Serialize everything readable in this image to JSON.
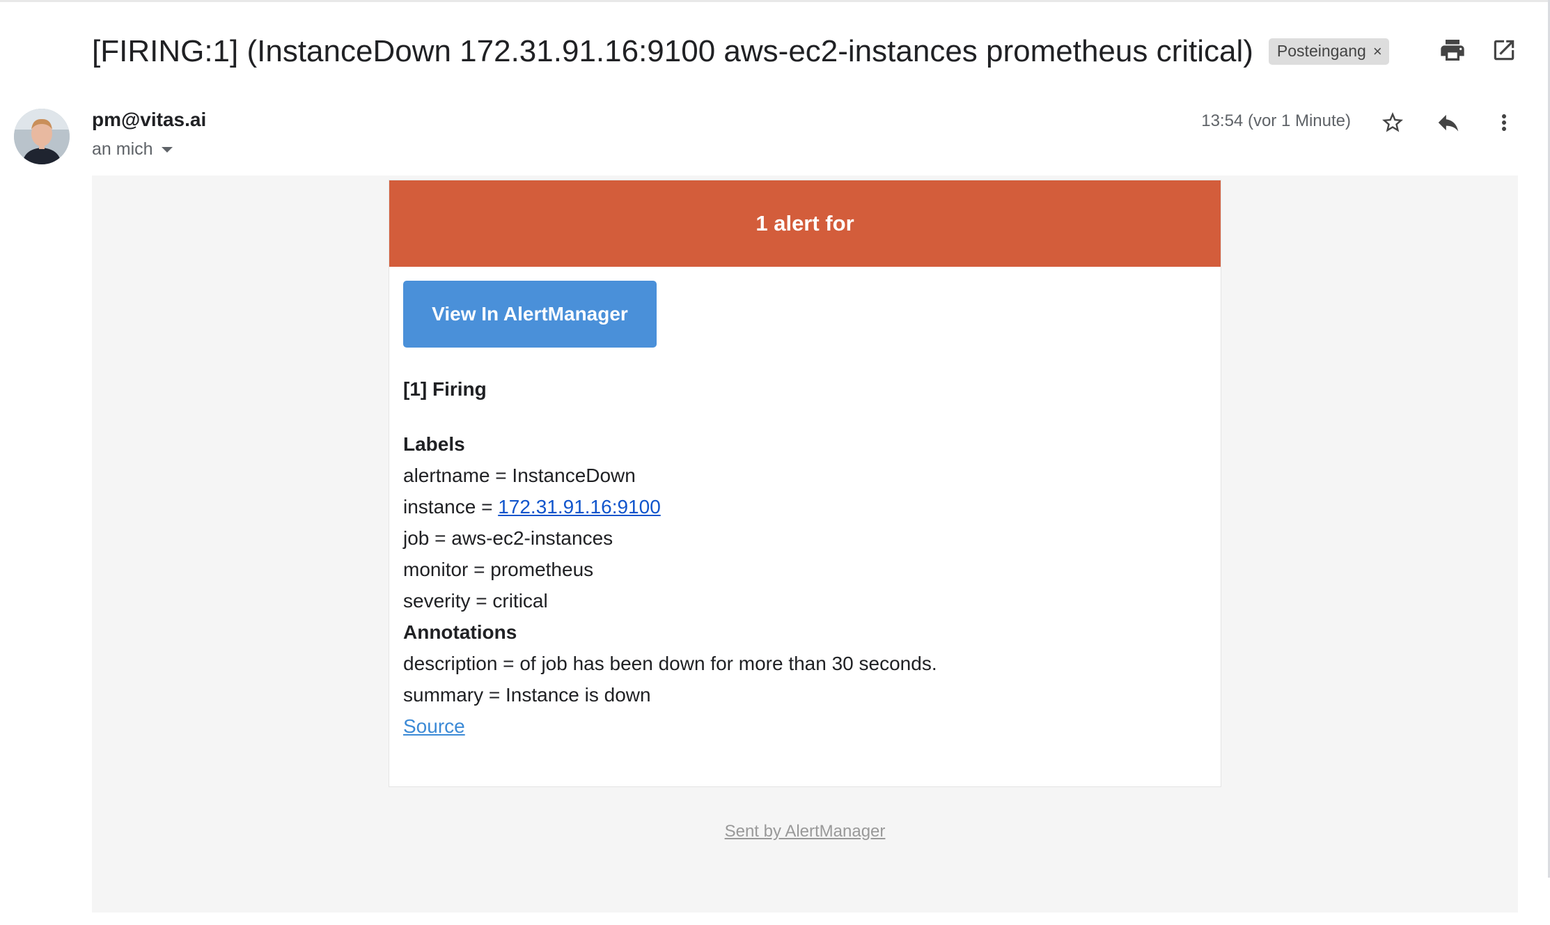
{
  "email": {
    "subject": "[FIRING:1] (InstanceDown 172.31.91.16:9100 aws-ec2-instances prometheus critical)",
    "label_chip": "Posteingang",
    "label_chip_close": "×",
    "sender": "pm@vitas.ai",
    "recipient": "an mich",
    "timestamp": "13:54 (vor 1 Minute)"
  },
  "icons": {
    "print": "print-icon",
    "open_new_window": "open-in-new-window-icon",
    "star": "star-icon",
    "reply": "reply-icon",
    "more": "more-vert-icon"
  },
  "alert": {
    "header": "1 alert for",
    "button_label": "View In AlertManager",
    "firing_title": "[1] Firing",
    "labels_title": "Labels",
    "labels": {
      "alertname": "alertname = InstanceDown",
      "instance_prefix": "instance = ",
      "instance_value": "172.31.91.16:9100",
      "job": "job = aws-ec2-instances",
      "monitor": "monitor = prometheus",
      "severity": "severity = critical"
    },
    "annotations_title": "Annotations",
    "annotations": {
      "description": "description = of job has been down for more than 30 seconds.",
      "summary": "summary = Instance is down"
    },
    "source_link": "Source",
    "footer": "Sent by AlertManager"
  },
  "colors": {
    "alert_header": "#d35d3b",
    "button": "#4a90d9",
    "link": "#1155cc",
    "source_link": "#3c8ad6",
    "body_bg": "#f5f5f5"
  }
}
